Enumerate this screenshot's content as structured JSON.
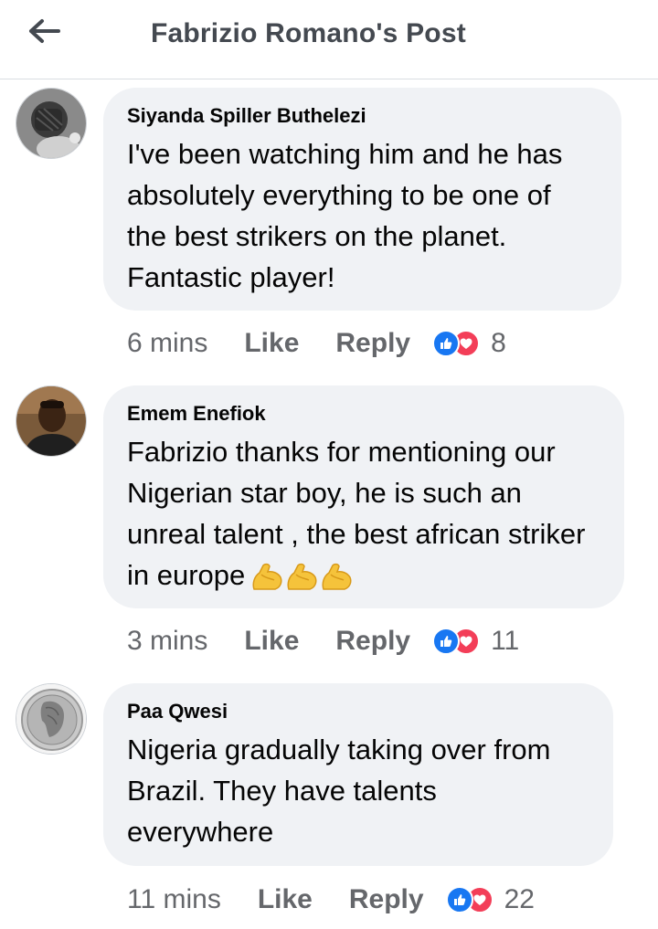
{
  "header": {
    "title": "Fabrizio Romano's Post"
  },
  "comments": [
    {
      "author": "Siyanda Spiller Buthelezi",
      "text": "I've been watching him and he has absolutely everything to be one of the best strikers on the planet. Fantastic player!",
      "time": "6 mins",
      "like_label": "Like",
      "reply_label": "Reply",
      "reaction_count": "8"
    },
    {
      "author": "Emem Enefiok",
      "text": "Fabrizio thanks for mentioning our Nigerian star boy, he is such an unreal talent , the best african striker in europe",
      "emojis": [
        "flexed-biceps-emoji",
        "flexed-biceps-emoji",
        "flexed-biceps-emoji"
      ],
      "time": "3 mins",
      "like_label": "Like",
      "reply_label": "Reply",
      "reaction_count": "11"
    },
    {
      "author": "Paa Qwesi",
      "text": "Nigeria gradually taking over from Brazil. They have talents everywhere",
      "time": "11 mins",
      "like_label": "Like",
      "reply_label": "Reply",
      "reaction_count": "22"
    }
  ],
  "colors": {
    "like_blue": "#1877f2",
    "love_red": "#f33e58",
    "bubble": "#f0f2f5",
    "meta_gray": "#65676b"
  }
}
